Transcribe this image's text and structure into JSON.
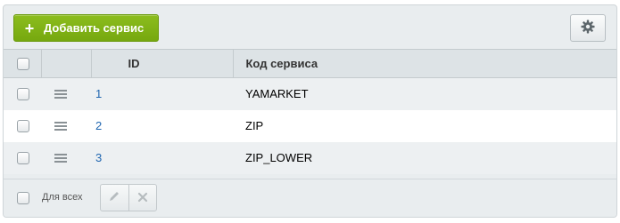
{
  "toolbar": {
    "add_label": "Добавить сервис",
    "add_icon": "plus-icon",
    "settings_icon": "gear-icon"
  },
  "table": {
    "columns": [
      "ID",
      "Код сервиса"
    ],
    "rows": [
      {
        "id": "1",
        "code": "YAMARKET"
      },
      {
        "id": "2",
        "code": "ZIP"
      },
      {
        "id": "3",
        "code": "ZIP_LOWER"
      }
    ]
  },
  "footer": {
    "all_label": "Для всех",
    "edit_icon": "pencil-icon",
    "delete_icon": "close-icon"
  },
  "colors": {
    "accent": "#7fb315",
    "link": "#2066b0",
    "panel_bg": "#e9edef",
    "header_bg": "#dde3e6"
  }
}
